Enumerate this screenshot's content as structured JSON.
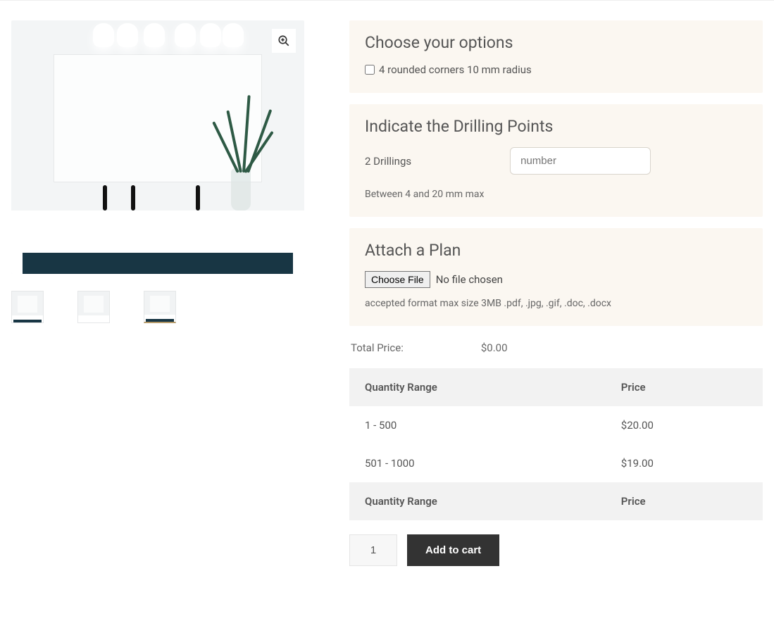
{
  "options": {
    "heading": "Choose your options",
    "checkbox_label": "4 rounded corners 10 mm radius"
  },
  "drilling": {
    "heading": "Indicate the Drilling Points",
    "label": "2 Drillings",
    "placeholder": "number",
    "hint": "Between 4 and 20 mm max"
  },
  "plan": {
    "heading": "Attach a Plan",
    "choose_label": "Choose File",
    "no_file": "No file chosen",
    "hint": "accepted format max size 3MB .pdf, .jpg, .gif, .doc, .docx"
  },
  "total": {
    "label": "Total Price:",
    "value": "$0.00"
  },
  "pricing": {
    "col_qty": "Quantity Range",
    "col_price": "Price",
    "rows": [
      {
        "range": "1 - 500",
        "price": "$20.00"
      },
      {
        "range": "501 - 1000",
        "price": "$19.00"
      }
    ]
  },
  "cart": {
    "qty_value": "1",
    "add_label": "Add to cart"
  }
}
